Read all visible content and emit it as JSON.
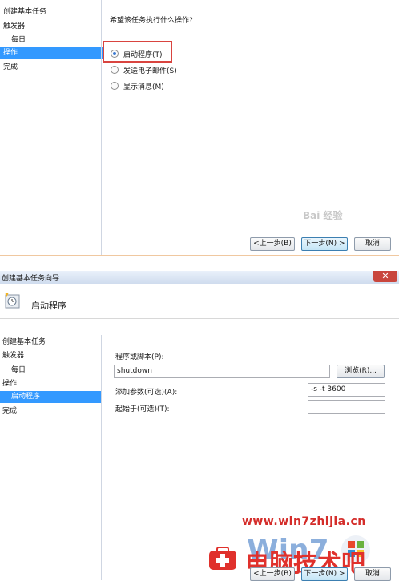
{
  "step1": {
    "nav": [
      "创建基本任务",
      "触发器",
      "每日",
      "操作",
      "完成"
    ],
    "question": "希望该任务执行什么操作?",
    "options": [
      "启动程序(T)",
      "发送电子邮件(S)",
      "显示消息(M)"
    ],
    "selected_option": 0,
    "buttons": {
      "back": "<上一步(B)",
      "next": "下一步(N) >",
      "cancel": "取消"
    },
    "watermark": "Bai 经验"
  },
  "step2": {
    "window_title": "创建基本任务向导",
    "close_label": "✕",
    "header_title": "启动程序",
    "nav": [
      "创建基本任务",
      "触发器",
      "每日",
      "操作",
      "启动程序",
      "完成"
    ],
    "program_label": "程序或脚本(P):",
    "program_value": "shutdown",
    "browse_label": "浏览(R)...",
    "args_label": "添加参数(可选)(A):",
    "args_value": "-s -t 3600",
    "start_in_label": "起始于(可选)(T):",
    "start_in_value": "",
    "buttons": {
      "back": "<上一步(B)",
      "next": "下一步(N) >",
      "cancel": "取消"
    },
    "site_url": "www.win7zhijia.cn",
    "logo_text": "电脑技术吧"
  },
  "colors": {
    "highlight": "#3399ff",
    "red_box": "#d9443f",
    "logo_red": "#e0312c"
  }
}
